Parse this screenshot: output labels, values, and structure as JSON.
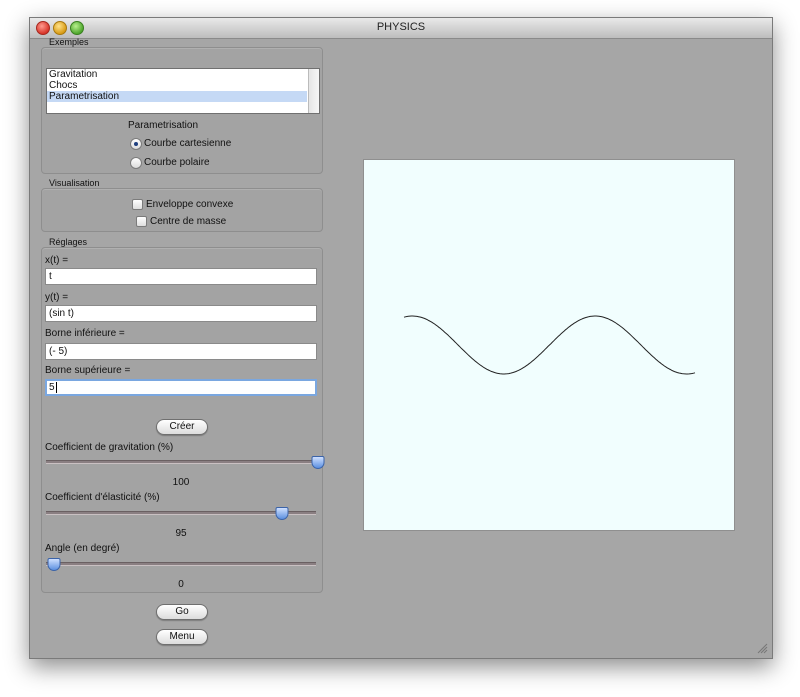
{
  "window": {
    "title": "PHYSICS"
  },
  "exemples": {
    "label": "Exemples",
    "items": [
      "Gravitation",
      "Chocs",
      "Parametrisation"
    ],
    "selected_index": 2,
    "heading": "Parametrisation",
    "radio_options": [
      {
        "label": "Courbe cartesienne",
        "checked": true
      },
      {
        "label": "Courbe polaire",
        "checked": false
      }
    ]
  },
  "visualisation": {
    "label": "Visualisation",
    "checkboxes": [
      {
        "label": "Enveloppe convexe",
        "checked": false
      },
      {
        "label": "Centre de masse",
        "checked": false
      }
    ]
  },
  "reglages": {
    "label": "Réglages",
    "fields": [
      {
        "label": "x(t) =",
        "value": "t"
      },
      {
        "label": "y(t) =",
        "value": "(sin t)"
      },
      {
        "label": "Borne inférieure =",
        "value": "(- 5)"
      },
      {
        "label": "Borne supérieure =",
        "value": "5"
      }
    ],
    "create_label": "Créer",
    "sliders": [
      {
        "label": "Coefficient de gravitation (%)",
        "value": 100,
        "min": 0,
        "max": 100
      },
      {
        "label": "Coefficient d'élasticité (%)",
        "value": 95,
        "min": 0,
        "max": 110
      },
      {
        "label": "Angle (en degré)",
        "value": 0,
        "min": 0,
        "max": 360
      }
    ]
  },
  "buttons": {
    "go": "Go",
    "menu": "Menu"
  },
  "plot": {
    "x_range": [
      -5,
      5
    ],
    "y_range": [
      -1,
      1
    ],
    "function": "(sin t)"
  }
}
